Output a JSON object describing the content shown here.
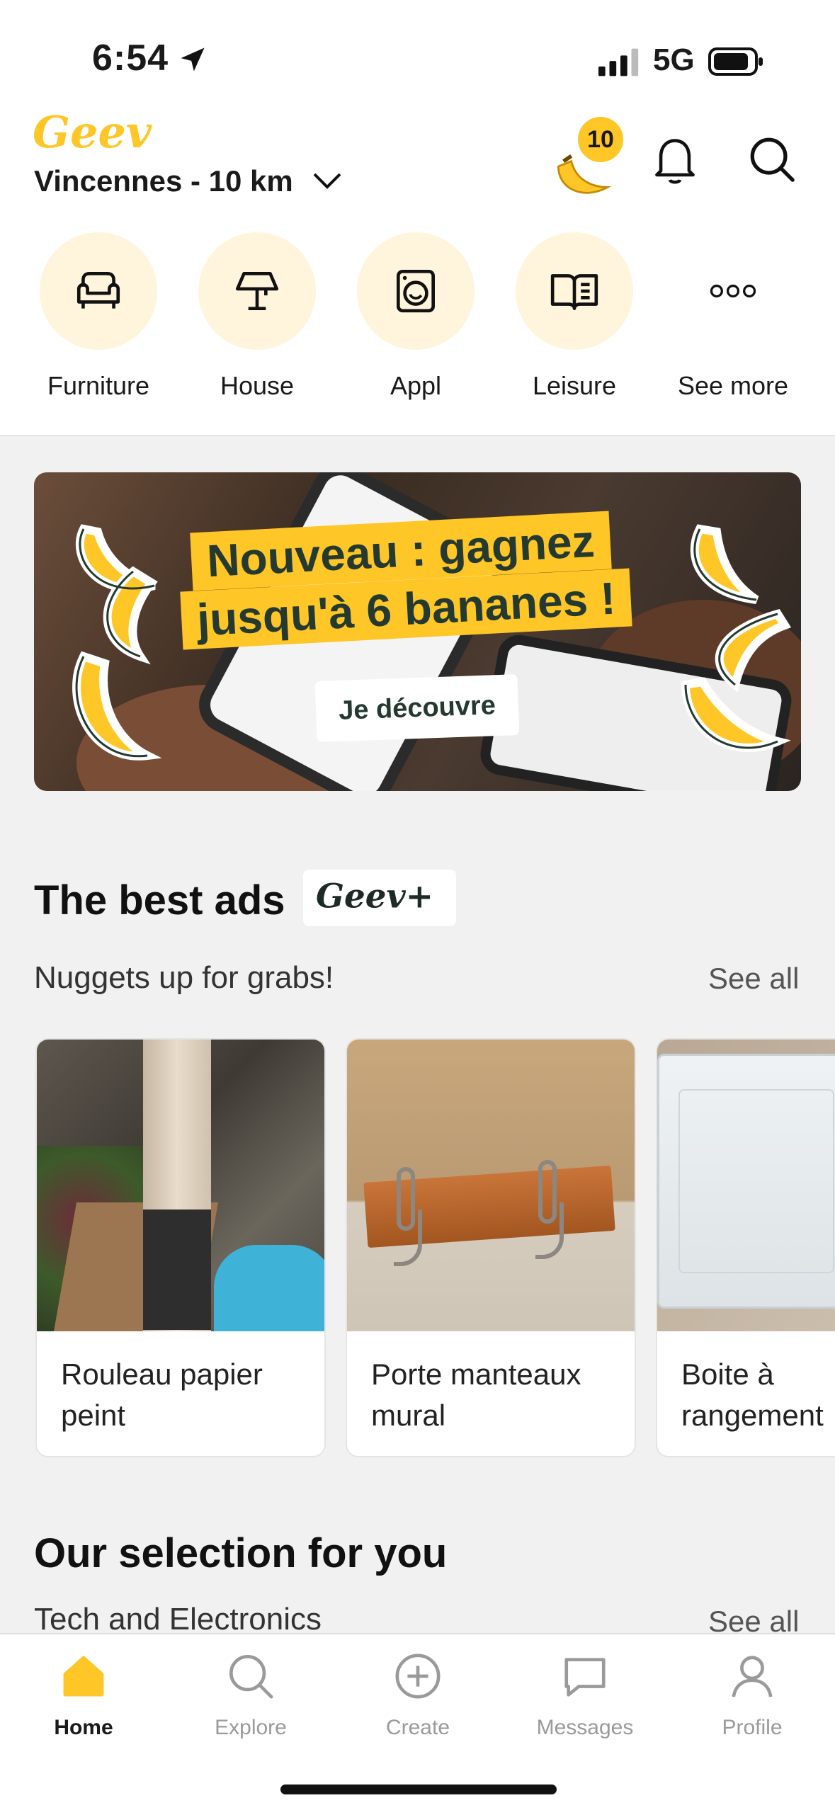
{
  "status_bar": {
    "time": "6:54",
    "network": "5G"
  },
  "header": {
    "logo_text": "Geev",
    "location": "Vincennes - 10 km",
    "banana_count": "10"
  },
  "categories": [
    {
      "label": "Furniture",
      "icon": "armchair-icon"
    },
    {
      "label": "House",
      "icon": "lamp-icon"
    },
    {
      "label": "Appl",
      "icon": "washing-machine-icon"
    },
    {
      "label": "Leisure",
      "icon": "book-icon"
    },
    {
      "label": "See more",
      "icon": "more-dots-icon"
    }
  ],
  "promo": {
    "headline_line1": "Nouveau : gagnez",
    "headline_line2": "jusqu'à 6 bananes !",
    "cta": "Je découvre"
  },
  "best_ads": {
    "title": "The best ads",
    "badge": "Geev+",
    "subtitle": "Nuggets up for grabs!",
    "see_all": "See all",
    "items": [
      {
        "title": "Rouleau papier peint"
      },
      {
        "title": "Porte manteaux mural"
      },
      {
        "title": "Boite à rangement"
      }
    ]
  },
  "selection": {
    "title": "Our selection for you",
    "subtitle": "Tech and Electronics",
    "see_all": "See all"
  },
  "tab_bar": [
    {
      "label": "Home",
      "icon": "home-icon",
      "active": true
    },
    {
      "label": "Explore",
      "icon": "search-icon",
      "active": false
    },
    {
      "label": "Create",
      "icon": "plus-circle-icon",
      "active": false
    },
    {
      "label": "Messages",
      "icon": "message-icon",
      "active": false
    },
    {
      "label": "Profile",
      "icon": "profile-icon",
      "active": false
    }
  ],
  "colors": {
    "accent": "#ffc627",
    "category_bg": "#fff4dc",
    "dark_green": "#243a31"
  }
}
